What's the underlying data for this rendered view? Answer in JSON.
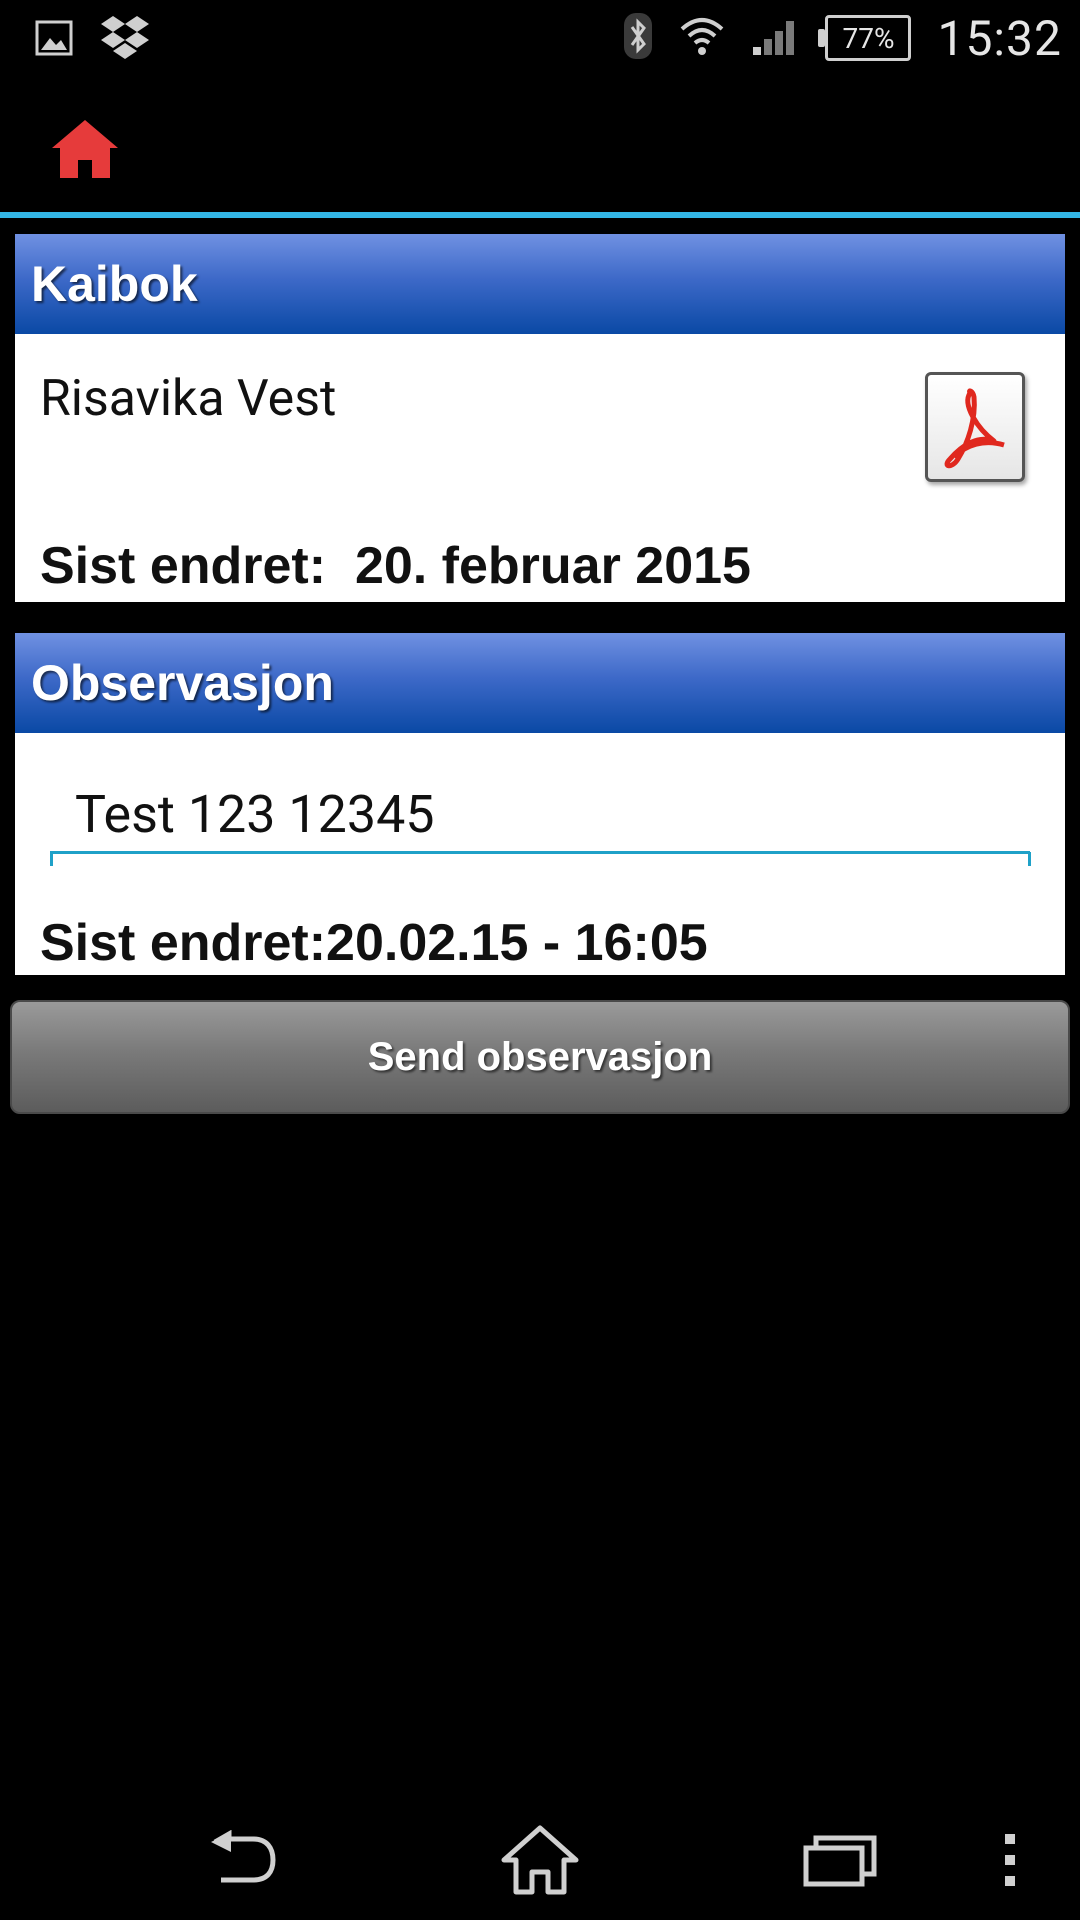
{
  "status_bar": {
    "time": "15:32",
    "battery": "77%",
    "icons": [
      "gallery-icon",
      "dropbox-icon",
      "bluetooth-icon",
      "wifi-icon",
      "signal-icon"
    ]
  },
  "action_bar": {
    "home_icon": "home-icon",
    "home_color": "#e63b3b",
    "divider_color": "#33b5e5"
  },
  "kaibok": {
    "title": "Kaibok",
    "place": "Risavika Vest",
    "modified": "Sist endret:  20. februar 2015",
    "document_icon": "pdf-icon"
  },
  "observasjon": {
    "title": "Observasjon",
    "input_value": "Test 123 12345",
    "modified": "Sist endret:20.02.15 - 16:05"
  },
  "send_button": {
    "label": "Send observasjon"
  },
  "nav_bar": {
    "back_icon": "back-icon",
    "home_icon": "home-outline-icon",
    "recents_icon": "recent-apps-icon",
    "menu_icon": "overflow-menu-icon"
  },
  "colors": {
    "header_gradient_top": "#7091e2",
    "header_gradient_bottom": "#0a49a5",
    "input_underline": "#1fa1c8"
  }
}
